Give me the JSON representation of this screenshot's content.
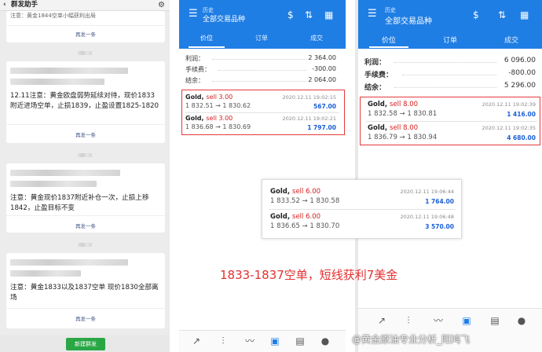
{
  "wechat": {
    "title": "群发助手",
    "back_glyph": "‹",
    "top_msg": "注意：黄金1844空单小幅获利出局",
    "resend_label": "再发一条",
    "new_broadcast": "新建群发",
    "messages": [
      {
        "text": "12.11注意：黄金欧盘弱势延续对待，现价1833附近进场空单，止损1839，止盈设置1825-1820"
      },
      {
        "text": "注意：黄金现价1837附近补仓一次，止损上移1842，止盈目标不变"
      },
      {
        "text": "注意：黄金1833以及1837空单 现价1830全部离场"
      }
    ]
  },
  "phone1": {
    "header_sub": "历史",
    "header_main": "全部交易品种",
    "tabs": [
      "价位",
      "订单",
      "成交"
    ],
    "summary": [
      {
        "label": "利润：",
        "value": "2 364.00"
      },
      {
        "label": "手续费：",
        "value": "-300.00"
      },
      {
        "label": "结余：",
        "value": "2 064.00"
      }
    ],
    "deals": [
      {
        "symbol": "Gold,",
        "side": "sell 3.00",
        "time": "2020.12.11 19:02:15",
        "prices": "1 832.51 → 1 830.62",
        "profit": "567.00"
      },
      {
        "symbol": "Gold,",
        "side": "sell 3.00",
        "time": "2020.12.11 19:02:21",
        "prices": "1 836.68 → 1 830.69",
        "profit": "1 797.00"
      }
    ]
  },
  "phone2": {
    "header_sub": "历史",
    "header_main": "全部交易品种",
    "tabs": [
      "价位",
      "订单",
      "成交"
    ],
    "summary": [
      {
        "label": "利润：",
        "value": "6 096.00"
      },
      {
        "label": "手续费：",
        "value": "-800.00"
      },
      {
        "label": "结余：",
        "value": "5 296.00"
      }
    ],
    "deals": [
      {
        "symbol": "Gold,",
        "side": "sell 8.00",
        "time": "2020.12.11 19:02:39",
        "prices": "1 832.58 → 1 830.81",
        "profit": "1 416.00"
      },
      {
        "symbol": "Gold,",
        "side": "sell 8.00",
        "time": "2020.12.11 19:02:35",
        "prices": "1 836.79 → 1 830.94",
        "profit": "4 680.00"
      }
    ]
  },
  "popup": {
    "deals": [
      {
        "symbol": "Gold,",
        "side": "sell 6.00",
        "time": "2020.12.11 19:06:44",
        "prices": "1 833.52 → 1 830.58",
        "profit": "1 764.00"
      },
      {
        "symbol": "Gold,",
        "side": "sell 6.00",
        "time": "2020.12.11 19:06:48",
        "prices": "1 836.65 → 1 830.70",
        "profit": "3 570.00"
      }
    ]
  },
  "caption": "1833-1837空单，短线获利7美金",
  "watermark": "@黄金原油专业分析_阳鸿飞",
  "colors": {
    "mt_blue": "#1f7ee4",
    "sell_red": "#d41d1d",
    "profit_blue": "#1a5ed6",
    "wechat_green": "#2aa745",
    "highlight_red": "#e33b3b"
  },
  "icons": {
    "menu": "☰",
    "sort": "⇅",
    "calendar": "▦",
    "currency": "$",
    "gear": "⚙",
    "nav": [
      "↗",
      "⫶",
      "〰",
      "▣",
      "▤",
      "●"
    ]
  }
}
